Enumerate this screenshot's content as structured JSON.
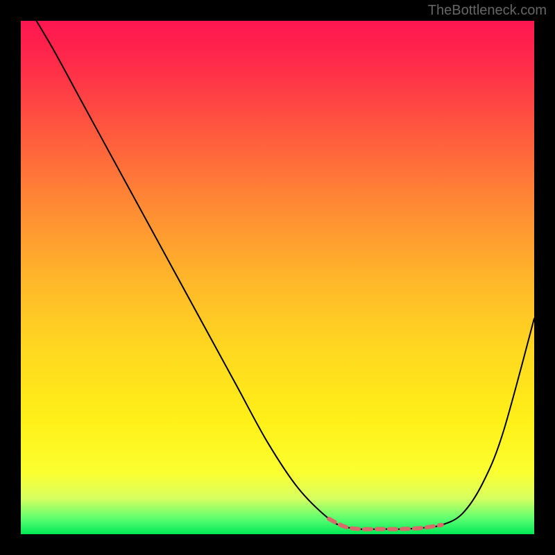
{
  "watermark": "TheBottleneck.com",
  "chart_data": {
    "type": "line",
    "title": "",
    "xlabel": "",
    "ylabel": "",
    "xlim": [
      0,
      100
    ],
    "ylim": [
      0,
      100
    ],
    "series": [
      {
        "name": "bottleneck-curve",
        "x": [
          0,
          6,
          12,
          18,
          24,
          30,
          36,
          42,
          48,
          54,
          60,
          63,
          66,
          70,
          74,
          78,
          82,
          86,
          90,
          94,
          100
        ],
        "y": [
          105,
          95,
          84,
          73,
          62,
          51,
          40,
          29,
          18,
          9,
          3,
          1.5,
          1,
          1,
          1,
          1.2,
          1.8,
          4,
          10,
          20,
          42
        ]
      }
    ],
    "optimal_zone": {
      "x_start": 60,
      "x_end": 84,
      "marker_color": "#d86a6a"
    },
    "gradient_stops": [
      {
        "pos": 0,
        "color": "#ff1650"
      },
      {
        "pos": 50,
        "color": "#ffd820"
      },
      {
        "pos": 88,
        "color": "#fbff30"
      },
      {
        "pos": 100,
        "color": "#00e858"
      }
    ]
  }
}
